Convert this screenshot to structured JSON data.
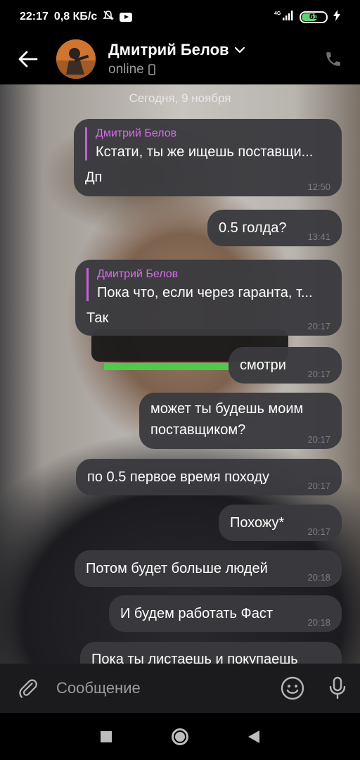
{
  "status_bar": {
    "time": "22:17",
    "speed": "0,8 КБ/с",
    "network": "4G",
    "battery": "61"
  },
  "header": {
    "contact_name": "Дмитрий Белов",
    "status": "online"
  },
  "chat": {
    "date": "Сегодня, 9 ноября",
    "messages": [
      {
        "reply_name": "Дмитрий Белов",
        "reply_text": "Кстати, ты же ищешь поставщи...",
        "text": "Дп",
        "time": "12:50"
      },
      {
        "text": "0.5 голда?",
        "time": "13:41"
      },
      {
        "reply_name": "Дмитрий Белов",
        "reply_text": "Пока что, если через гаранта, т...",
        "text": "Так",
        "time": "20:17"
      },
      {
        "text": "смотри",
        "time": "20:17"
      },
      {
        "text_line1": "может ты будешь моим",
        "text_line2": "поставщиком?",
        "time": "20:17"
      },
      {
        "text": "по 0.5 первое время походу",
        "time": "20:17"
      },
      {
        "text": "Похожу*",
        "time": "20:17"
      },
      {
        "text": "Потом будет больше людей",
        "time": "20:18"
      },
      {
        "text": "И будем работать Фаст",
        "time": "20:18"
      },
      {
        "text": "Пока ты листаешь и покупаешь"
      }
    ]
  },
  "input": {
    "placeholder": "Сообщение"
  },
  "colors": {
    "bubble": "#3a3a3e",
    "reply_accent": "#d66be8",
    "battery_fill": "#5fd36b"
  }
}
